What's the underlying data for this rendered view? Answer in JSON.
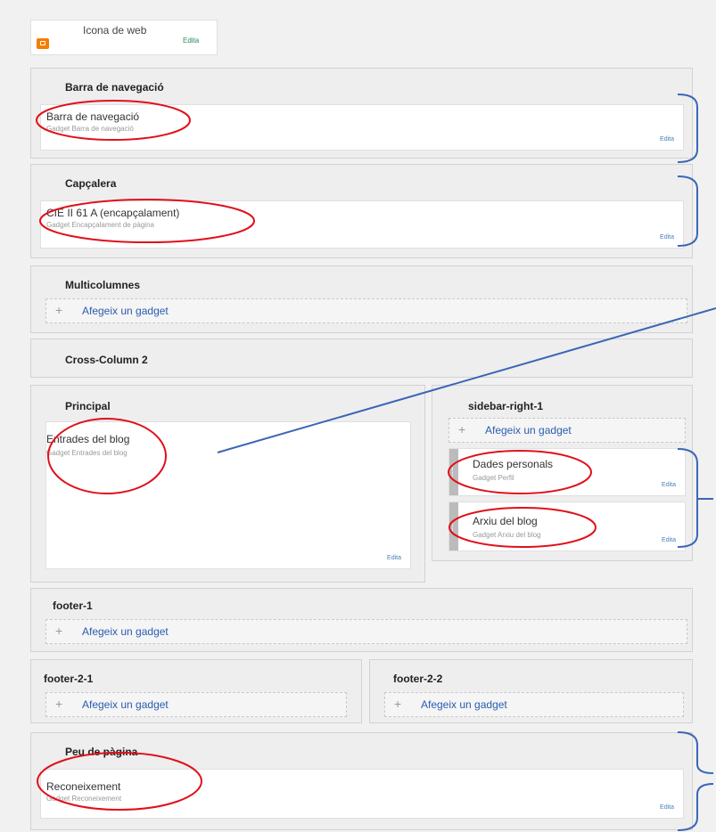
{
  "favicon": {
    "title": "Icona de web",
    "edit": "Edita"
  },
  "sections": {
    "navbar": {
      "title": "Barra de navegació",
      "gadget_title": "Barra de navegació",
      "gadget_sub": "Gadget Barra de navegació",
      "edit": "Edita"
    },
    "header": {
      "title": "Capçalera",
      "gadget_title": "CIE II 61 A (encapçalament)",
      "gadget_sub": "Gadget Encapçalament de pàgina",
      "edit": "Edita"
    },
    "multicol": {
      "title": "Multicolumnes",
      "add": "Afegeix un gadget"
    },
    "cross2": {
      "title": "Cross-Column 2"
    },
    "main": {
      "title": "Principal",
      "gadget_title": "Entrades del blog",
      "gadget_sub": "Gadget Entrades del blog",
      "edit": "Edita"
    },
    "sidebar": {
      "title": "sidebar-right-1",
      "add": "Afegeix un gadget",
      "profile_title": "Dades personals",
      "profile_sub": "Gadget Perfil",
      "profile_edit": "Edita",
      "archive_title": "Arxiu del blog",
      "archive_sub": "Gadget Arxiu del blog",
      "archive_edit": "Edita"
    },
    "footer1": {
      "title": "footer-1",
      "add": "Afegeix un gadget"
    },
    "footer21": {
      "title": "footer-2-1",
      "add": "Afegeix un gadget"
    },
    "footer22": {
      "title": "footer-2-2",
      "add": "Afegeix un gadget"
    },
    "footer": {
      "title": "Peu de pàgina",
      "gadget_title": "Reconeixement",
      "gadget_sub": "Gadget Reconeixement",
      "edit": "Edita"
    }
  },
  "colors": {
    "annotation_red": "#e0101a",
    "annotation_blue": "#3a66b6",
    "link": "#2a5db0"
  },
  "icons": {
    "favicon": "blogger-icon",
    "add": "plus-icon"
  }
}
